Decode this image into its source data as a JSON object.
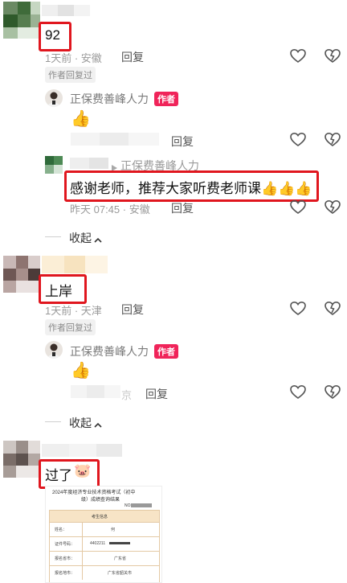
{
  "comments": [
    {
      "text": "92",
      "time_location": "1天前 · 安徽",
      "reply_label": "回复",
      "author_replied_badge": "作者回复过",
      "author_reply": {
        "name": "正保费善峰人力",
        "tag": "作者",
        "content": "👍",
        "reply_label": "回复"
      },
      "sub_reply": {
        "reply_to": "正保费善峰人力",
        "text": "感谢老师，推荐大家听费老师课👍👍👍",
        "time_location": "昨天 07:45 · 安徽",
        "reply_label": "回复"
      },
      "collapse_label": "收起"
    },
    {
      "text": "上岸",
      "time_location": "1天前 · 天津",
      "reply_label": "回复",
      "author_replied_badge": "作者回复过",
      "author_reply": {
        "name": "正保费善峰人力",
        "tag": "作者",
        "content": "👍",
        "reply_label": "回复",
        "time_fragment": "京"
      },
      "collapse_label": "收起"
    },
    {
      "text": "过了",
      "emoji": "🐷",
      "image": {
        "title_line1": "2024年度经济专业技术资格考试（初中",
        "title_line2": "级）成绩查询结果",
        "no_label": "NO.",
        "section": "考生信息",
        "rows": [
          {
            "label": "姓名：",
            "value": "何"
          },
          {
            "label": "证件号码：",
            "value": "4402211"
          },
          {
            "label": "报名省市：",
            "value": "广东省"
          },
          {
            "label": "报名地市：",
            "value": "广东省韶关市"
          }
        ]
      }
    }
  ],
  "colors": {
    "highlight": "#e0161e",
    "author_tag": "#f0245a",
    "meta": "#9a9a9a"
  },
  "icons": [
    "heart-icon",
    "dislike-icon",
    "chevron-up-icon"
  ]
}
